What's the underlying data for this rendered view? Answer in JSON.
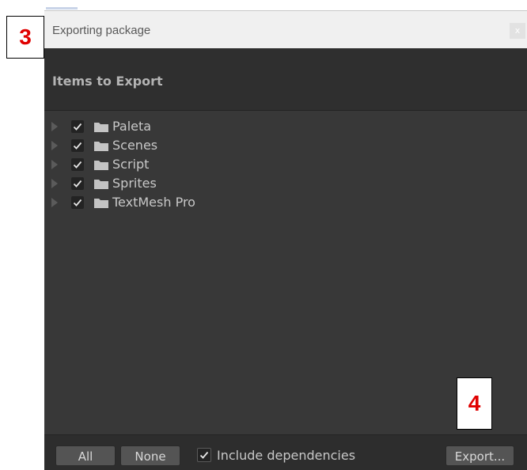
{
  "annotations": {
    "callout_3": "3",
    "callout_4": "4",
    "color": "#e00000"
  },
  "window": {
    "title": "Exporting package",
    "close_label": "x",
    "header_title": "Items to Export"
  },
  "tree": {
    "items": [
      {
        "label": "Paleta",
        "checked": true,
        "icon": "folder-icon",
        "expander": "triangle-right-icon"
      },
      {
        "label": "Scenes",
        "checked": true,
        "icon": "folder-icon",
        "expander": "triangle-right-icon"
      },
      {
        "label": "Script",
        "checked": true,
        "icon": "folder-icon",
        "expander": "triangle-right-icon"
      },
      {
        "label": "Sprites",
        "checked": true,
        "icon": "folder-icon",
        "expander": "triangle-right-icon"
      },
      {
        "label": "TextMesh Pro",
        "checked": true,
        "icon": "folder-icon",
        "expander": "triangle-right-icon"
      }
    ]
  },
  "footer": {
    "all_label": "All",
    "none_label": "None",
    "include_dependencies_label": "Include dependencies",
    "include_dependencies_checked": true,
    "export_label": "Export..."
  },
  "colors": {
    "window_bg": "#383838",
    "header_bg": "#2f2f2f",
    "footer_bg": "#2d2d2d",
    "text": "#c8c8c8",
    "button_bg": "#545454"
  }
}
